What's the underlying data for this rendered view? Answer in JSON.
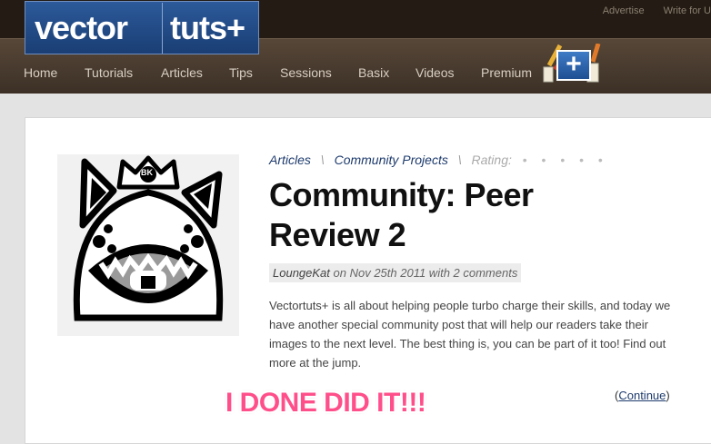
{
  "header": {
    "logo_left": "vector",
    "logo_right": "tuts+",
    "top_links": [
      "Advertise",
      "Write for U"
    ],
    "nav": [
      "Home",
      "Tutorials",
      "Articles",
      "Tips",
      "Sessions",
      "Basix",
      "Videos",
      "Premium"
    ],
    "premium_badge": "+"
  },
  "post": {
    "breadcrumb": [
      "Articles",
      "Community Projects"
    ],
    "rating_label": "Rating:",
    "rating_dots": "• • • • •",
    "title": "Community: Peer Review 2",
    "meta": {
      "author": "LoungeKat",
      "date_text": " on Nov 25th 2011 with 2 comments"
    },
    "excerpt": "Vectortuts+ is all about helping people turbo charge their skills, and today we have another special community post that will help our readers take their images to the next level. The best thing is, you can be part of it too! Find out more at the jump.",
    "continue_label": "Continue",
    "thumb_badge": "BK"
  },
  "overlay_caption": "I DONE DID IT!!!",
  "colors": {
    "header_dark": "#231b14",
    "nav_bg": "#4a3c30",
    "logo_blue": "#2c5a9a",
    "link": "#1e3b6d",
    "caption_pink": "#ff4f8b"
  }
}
